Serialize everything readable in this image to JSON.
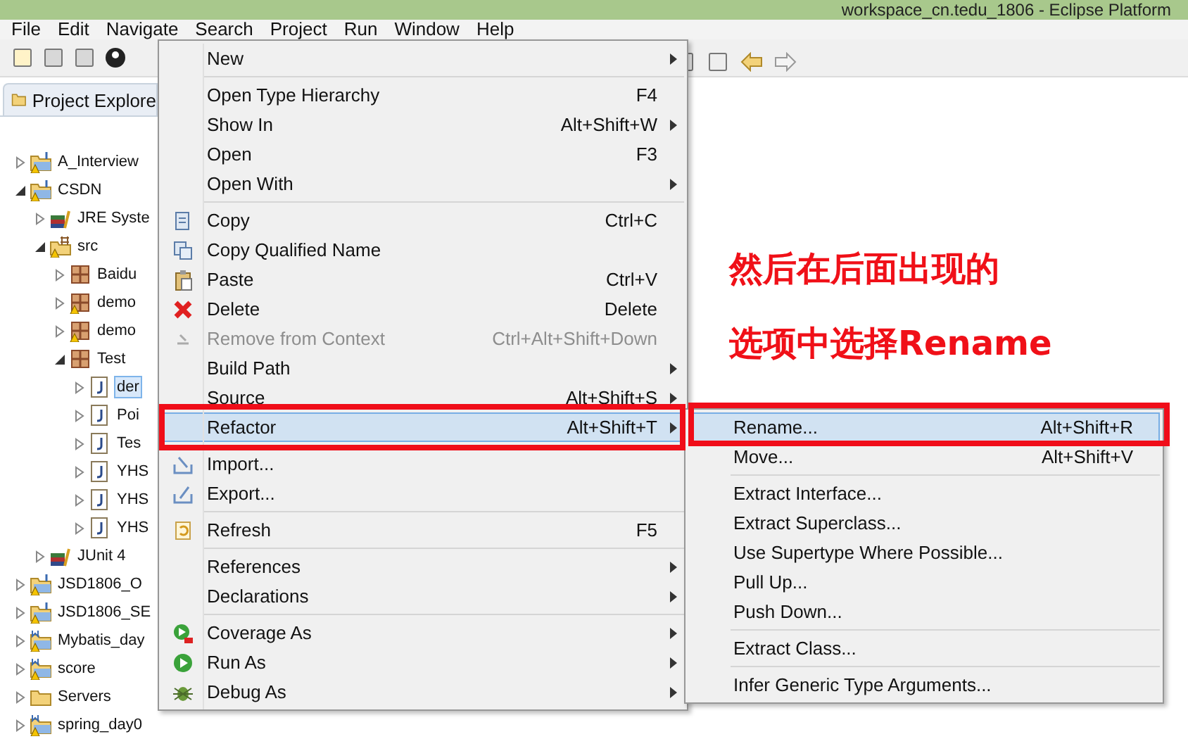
{
  "window": {
    "title": "workspace_cn.tedu_1806 - Eclipse Platform"
  },
  "menu_bar": [
    "File",
    "Edit",
    "Navigate",
    "Search",
    "Project",
    "Run",
    "Window",
    "Help"
  ],
  "explorer": {
    "title": "Project Explore",
    "tree": [
      {
        "label": "A_Interview",
        "kind": "project",
        "warning": true,
        "expanded": false,
        "selected": false
      },
      {
        "label": "CSDN",
        "kind": "project",
        "warning": true,
        "expanded": true,
        "selected": false,
        "children": [
          {
            "label": "JRE Syste",
            "kind": "library",
            "warning": false,
            "expanded": false,
            "selected": false
          },
          {
            "label": "src",
            "kind": "source",
            "warning": true,
            "expanded": true,
            "selected": false,
            "children": [
              {
                "label": "Baidu",
                "kind": "package",
                "warning": false,
                "expanded": false,
                "selected": false
              },
              {
                "label": "demo",
                "kind": "package",
                "warning": true,
                "expanded": false,
                "selected": false
              },
              {
                "label": "demo",
                "kind": "package",
                "warning": true,
                "expanded": false,
                "selected": false
              },
              {
                "label": "Test",
                "kind": "package",
                "warning": false,
                "expanded": true,
                "selected": false,
                "children": [
                  {
                    "label": "der",
                    "kind": "file",
                    "warning": false,
                    "expanded": false,
                    "selected": true
                  },
                  {
                    "label": "Poi",
                    "kind": "file",
                    "warning": false,
                    "expanded": false,
                    "selected": false
                  },
                  {
                    "label": "Tes",
                    "kind": "file",
                    "warning": false,
                    "expanded": false,
                    "selected": false
                  },
                  {
                    "label": "YHS",
                    "kind": "file",
                    "warning": false,
                    "expanded": false,
                    "selected": false
                  },
                  {
                    "label": "YHS",
                    "kind": "file",
                    "warning": false,
                    "expanded": false,
                    "selected": false
                  },
                  {
                    "label": "YHS",
                    "kind": "file",
                    "warning": false,
                    "expanded": false,
                    "selected": false
                  }
                ]
              }
            ]
          },
          {
            "label": "JUnit 4",
            "kind": "library",
            "warning": false,
            "expanded": false,
            "selected": false
          }
        ]
      },
      {
        "label": "JSD1806_O",
        "kind": "project",
        "warning": true,
        "expanded": false,
        "selected": false
      },
      {
        "label": "JSD1806_SE",
        "kind": "project",
        "warning": true,
        "expanded": false,
        "selected": false
      },
      {
        "label": "Mybatis_day",
        "kind": "maven",
        "warning": true,
        "expanded": false,
        "selected": false
      },
      {
        "label": "score",
        "kind": "maven",
        "warning": true,
        "expanded": false,
        "selected": false
      },
      {
        "label": "Servers",
        "kind": "folder",
        "warning": false,
        "expanded": false,
        "selected": false
      },
      {
        "label": "spring_day0",
        "kind": "maven",
        "warning": true,
        "expanded": false,
        "selected": false
      }
    ]
  },
  "context_menu": [
    {
      "kind": "item",
      "label": "New",
      "submenu": true,
      "disabled": false,
      "selected": false
    },
    {
      "kind": "separator"
    },
    {
      "kind": "item",
      "label": "Open Type Hierarchy",
      "shortcut": "F4",
      "submenu": false,
      "disabled": false,
      "selected": false
    },
    {
      "kind": "item",
      "label": "Show In",
      "shortcut": "Alt+Shift+W",
      "submenu": true,
      "disabled": false,
      "selected": false
    },
    {
      "kind": "item",
      "label": "Open",
      "shortcut": "F3",
      "submenu": false,
      "disabled": false,
      "selected": false
    },
    {
      "kind": "item",
      "label": "Open With",
      "submenu": true,
      "disabled": false,
      "selected": false
    },
    {
      "kind": "separator"
    },
    {
      "kind": "item",
      "label": "Copy",
      "shortcut": "Ctrl+C",
      "submenu": false,
      "disabled": false,
      "selected": false
    },
    {
      "kind": "item",
      "label": "Copy Qualified Name",
      "submenu": false,
      "disabled": false,
      "selected": false
    },
    {
      "kind": "item",
      "label": "Paste",
      "shortcut": "Ctrl+V",
      "submenu": false,
      "disabled": false,
      "selected": false
    },
    {
      "kind": "item",
      "label": "Delete",
      "shortcut": "Delete",
      "submenu": false,
      "disabled": false,
      "selected": false
    },
    {
      "kind": "item",
      "label": "Remove from Context",
      "shortcut": "Ctrl+Alt+Shift+Down",
      "submenu": false,
      "disabled": true,
      "selected": false
    },
    {
      "kind": "item",
      "label": "Build Path",
      "submenu": true,
      "disabled": false,
      "selected": false
    },
    {
      "kind": "item",
      "label": "Source",
      "shortcut": "Alt+Shift+S",
      "submenu": true,
      "disabled": false,
      "selected": false
    },
    {
      "kind": "item",
      "label": "Refactor",
      "shortcut": "Alt+Shift+T",
      "submenu": true,
      "disabled": false,
      "selected": true
    },
    {
      "kind": "separator"
    },
    {
      "kind": "item",
      "label": "Import...",
      "submenu": false,
      "disabled": false,
      "selected": false
    },
    {
      "kind": "item",
      "label": "Export...",
      "submenu": false,
      "disabled": false,
      "selected": false
    },
    {
      "kind": "separator"
    },
    {
      "kind": "item",
      "label": "Refresh",
      "shortcut": "F5",
      "submenu": false,
      "disabled": false,
      "selected": false
    },
    {
      "kind": "separator"
    },
    {
      "kind": "item",
      "label": "References",
      "submenu": true,
      "disabled": false,
      "selected": false
    },
    {
      "kind": "item",
      "label": "Declarations",
      "submenu": true,
      "disabled": false,
      "selected": false
    },
    {
      "kind": "separator"
    },
    {
      "kind": "item",
      "label": "Coverage As",
      "submenu": true,
      "disabled": false,
      "selected": false
    },
    {
      "kind": "item",
      "label": "Run As",
      "submenu": true,
      "disabled": false,
      "selected": false
    },
    {
      "kind": "item",
      "label": "Debug As",
      "submenu": true,
      "disabled": false,
      "selected": false
    }
  ],
  "refactor_submenu": [
    {
      "kind": "item",
      "label": "Rename...",
      "shortcut": "Alt+Shift+R",
      "selected": true
    },
    {
      "kind": "item",
      "label": "Move...",
      "shortcut": "Alt+Shift+V",
      "selected": false
    },
    {
      "kind": "separator"
    },
    {
      "kind": "item",
      "label": "Extract Interface...",
      "selected": false
    },
    {
      "kind": "item",
      "label": "Extract Superclass...",
      "selected": false
    },
    {
      "kind": "item",
      "label": "Use Supertype Where Possible...",
      "selected": false
    },
    {
      "kind": "item",
      "label": "Pull Up...",
      "selected": false
    },
    {
      "kind": "item",
      "label": "Push Down...",
      "selected": false
    },
    {
      "kind": "separator"
    },
    {
      "kind": "item",
      "label": "Extract Class...",
      "selected": false
    },
    {
      "kind": "separator"
    },
    {
      "kind": "item",
      "label": "Infer Generic Type Arguments...",
      "selected": false
    }
  ],
  "annotation": [
    "然后在后面出现的",
    "选项中选择Rename"
  ]
}
